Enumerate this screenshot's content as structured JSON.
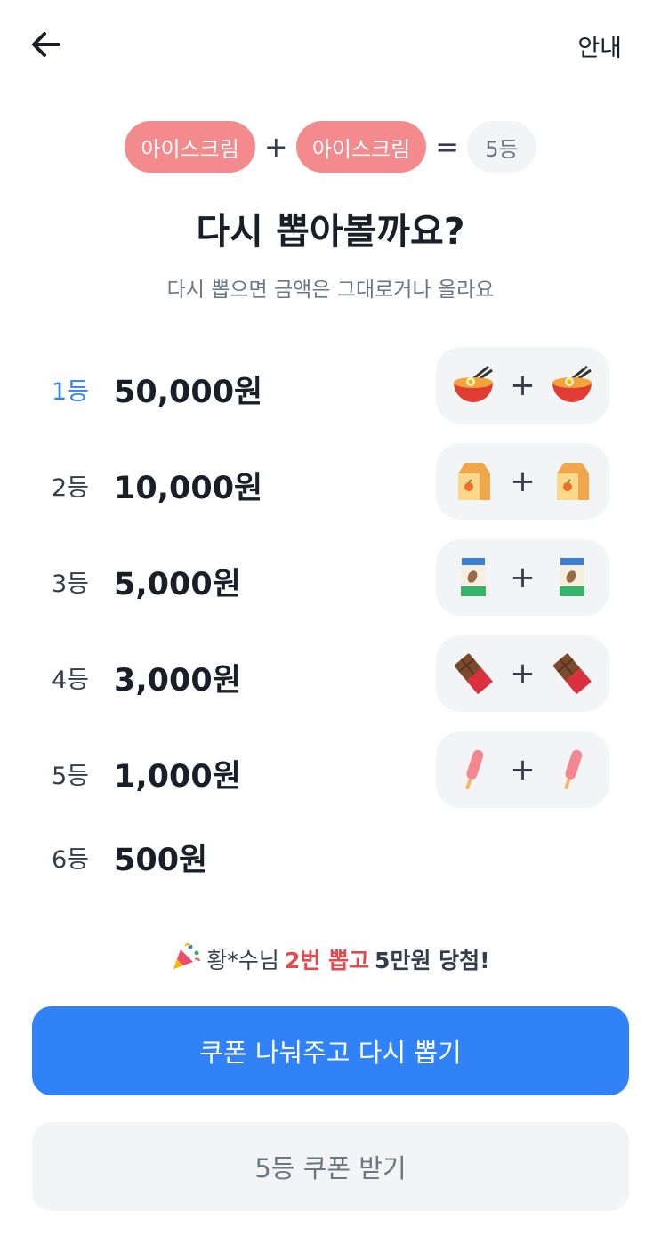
{
  "header": {
    "back_icon": "arrow-left-icon",
    "guide_label": "안내"
  },
  "combo": {
    "item1": "아이스크림",
    "plus": "+",
    "item2": "아이스크림",
    "equals": "=",
    "result": "5등"
  },
  "title": "다시 뽑아볼까요?",
  "subtitle": "다시 뽑으면 금액은 그대로거나 올라요",
  "prizes": [
    {
      "rank": "1등",
      "amount": "50,000원",
      "icon": "ramen-bowl-icon",
      "plus": "+"
    },
    {
      "rank": "2등",
      "amount": "10,000원",
      "icon": "juice-carton-icon",
      "plus": "+"
    },
    {
      "rank": "3등",
      "amount": "5,000원",
      "icon": "nut-snack-pack-icon",
      "plus": "+"
    },
    {
      "rank": "4등",
      "amount": "3,000원",
      "icon": "chocolate-bar-icon",
      "plus": "+"
    },
    {
      "rank": "5등",
      "amount": "1,000원",
      "icon": "ice-pop-icon",
      "plus": "+"
    },
    {
      "rank": "6등",
      "amount": "500원"
    }
  ],
  "winner": {
    "icon": "party-popper-icon",
    "name": "황*수님",
    "highlight": "2번 뽑고",
    "result": "5만원 당첨!"
  },
  "buttons": {
    "primary": "쿠폰 나눠주고 다시 뽑기",
    "secondary": "5등 쿠폰 받기"
  },
  "colors": {
    "accent": "#3182f6",
    "pill": "#f28a8e",
    "highlight": "#e5484d"
  }
}
